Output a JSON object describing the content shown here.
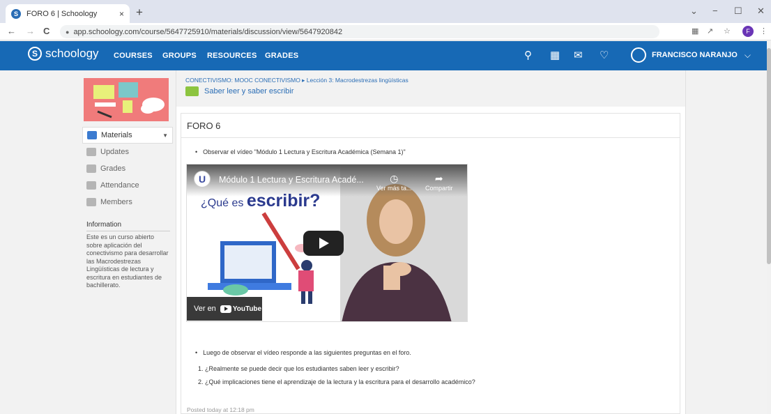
{
  "browser": {
    "tab_title": "FORO 6 | Schoology",
    "tab_favicon": "S",
    "tab_close": "×",
    "new_tab": "+",
    "url": "app.schoology.com/course/5647725910/materials/discussion/view/5647920842",
    "profile_initial": "F",
    "nav": {
      "back": "←",
      "forward": "→",
      "reload": "C"
    },
    "window_controls": {
      "minimize": "−",
      "maximize": "☐",
      "close": "✕",
      "dropdown": "⌄"
    }
  },
  "header": {
    "logo_text": "schoology",
    "logo_mark": "S",
    "nav_links": [
      "COURSES",
      "GROUPS",
      "RESOURCES",
      "GRADES"
    ],
    "user_name": "FRANCISCO NARANJO",
    "brand_color": "#1769b5"
  },
  "sidebar": {
    "items": [
      {
        "label": "Materials",
        "icon": "materials-icon"
      },
      {
        "label": "Updates",
        "icon": "updates-icon"
      },
      {
        "label": "Grades",
        "icon": "grades-icon"
      },
      {
        "label": "Attendance",
        "icon": "attendance-icon"
      },
      {
        "label": "Members",
        "icon": "members-icon"
      }
    ],
    "info_title": "Information",
    "info_text": "Este es un curso abierto sobre aplicación del conectivismo para desarrollar las Macrodestrezas Lingüísticas de lectura y escritura en estudiantes de bachillerato."
  },
  "breadcrumb": {
    "path": "CONECTIVISMO: MOOC CONECTIVISMO ▸ Lección 3: Macrodestrezas lingüísticas",
    "folder": "Saber leer y saber escribir"
  },
  "post": {
    "title": "FORO 6",
    "bullet1": "Observar el vídeo \"Módulo 1 Lectura y Escritura Académica (Semana 1)\"",
    "bullet2": "Luego de observar el vídeo responde a las siguientes preguntas en el foro.",
    "questions": [
      "1. ¿Realmente se puede decir que los estudiantes saben leer y escribir?",
      "2. ¿Qué implicaciones tiene el aprendizaje de la lectura y la escritura para el desarrollo académico?"
    ],
    "posted": "Posted today at 12:18 pm"
  },
  "video": {
    "channel_mark": "U",
    "title": "Módulo 1 Lectura y Escritura Acadé...",
    "watch_later": "Ver más ta...",
    "share": "Compartir",
    "headline_small": "¿Qué es",
    "headline_big": "escribir?",
    "watch_on": "Ver en",
    "youtube": "YouTube"
  }
}
